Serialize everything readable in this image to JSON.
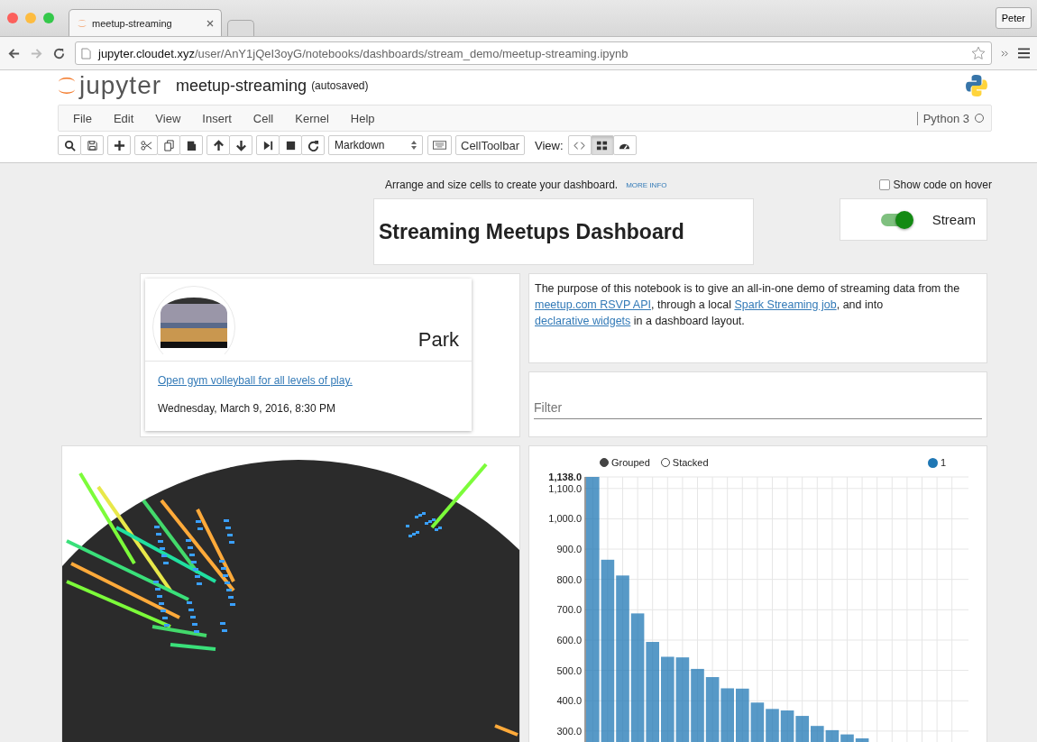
{
  "browser": {
    "tabs": [
      {
        "kind": "page",
        "title": "meetup-streaming",
        "selected": true
      },
      {
        "kind": "new",
        "selected": false
      }
    ],
    "profile": "Peter",
    "url": {
      "host": "jupyter.cloudet.xyz",
      "path": "/user/AnY1jQeI3oyG/notebooks/dashboards/stream_demo/meetup-streaming.ipynb"
    }
  },
  "notebook": {
    "logo": "jupyter",
    "name": "meetup-streaming",
    "status": "(autosaved)"
  },
  "menu": [
    "File",
    "Edit",
    "View",
    "Insert",
    "Cell",
    "Kernel",
    "Help"
  ],
  "kernel": {
    "name": "Python 3",
    "busy": false
  },
  "toolbar": {
    "cell_type": "Markdown",
    "celltoolbar": "CellToolbar",
    "view_label": "View:",
    "views": [
      {
        "kind": "code",
        "selected": false
      },
      {
        "kind": "grid",
        "selected": true
      },
      {
        "kind": "dashboard",
        "selected": false
      }
    ]
  },
  "dashboard_info": {
    "text": "Arrange and size cells to create your dashboard.",
    "link": "MORE INFO",
    "show_code_label": "Show code on hover",
    "show_code_checked": false
  },
  "title": "Streaming Meetups Dashboard",
  "stream": {
    "label": "Stream",
    "on": true
  },
  "event": {
    "venue": "Park",
    "name": "Open gym volleyball for all levels of play.",
    "time": "Wednesday, March 9, 2016, 8:30 PM"
  },
  "description": [
    {
      "text": "The purpose of this notebook is to give an all-in-one demo of streaming data from the ",
      "link": false
    },
    {
      "text": "meetup.com RSVP API",
      "link": true
    },
    {
      "text": ", through a local ",
      "link": false
    },
    {
      "text": "Spark Streaming job",
      "link": true
    },
    {
      "text": ", and into ",
      "link": false
    },
    {
      "text": "declarative widgets",
      "link": true
    },
    {
      "text": " in a dashboard layout.",
      "link": false
    }
  ],
  "filter": {
    "placeholder": "Filter"
  },
  "chart": {
    "modes": [
      {
        "label": "Grouped",
        "selected": true
      },
      {
        "label": "Stacked",
        "selected": false
      }
    ],
    "chart_data": {
      "type": "bar",
      "grid": true,
      "series": [
        {
          "name": "1",
          "color": "#1f77b4",
          "values": [
            1138,
            865,
            813,
            688,
            594,
            545,
            543,
            505,
            478,
            441,
            440,
            394,
            373,
            368,
            350,
            317,
            303,
            289,
            276,
            null,
            null,
            null,
            null,
            null,
            null
          ]
        }
      ],
      "ylim": [
        264,
        1138
      ],
      "yticks": [
        {
          "value": 300,
          "label": "300.0"
        },
        {
          "value": 400,
          "label": "400.0"
        },
        {
          "value": 500,
          "label": "500.0"
        },
        {
          "value": 600,
          "label": "600.0"
        },
        {
          "value": 700,
          "label": "700.0"
        },
        {
          "value": 800,
          "label": "800.0"
        },
        {
          "value": 900,
          "label": "900.0"
        },
        {
          "value": 1000,
          "label": "1,000.0"
        },
        {
          "value": 1100,
          "label": "1,100.0"
        },
        {
          "value": 1138,
          "label": "1,138.0"
        }
      ]
    }
  }
}
